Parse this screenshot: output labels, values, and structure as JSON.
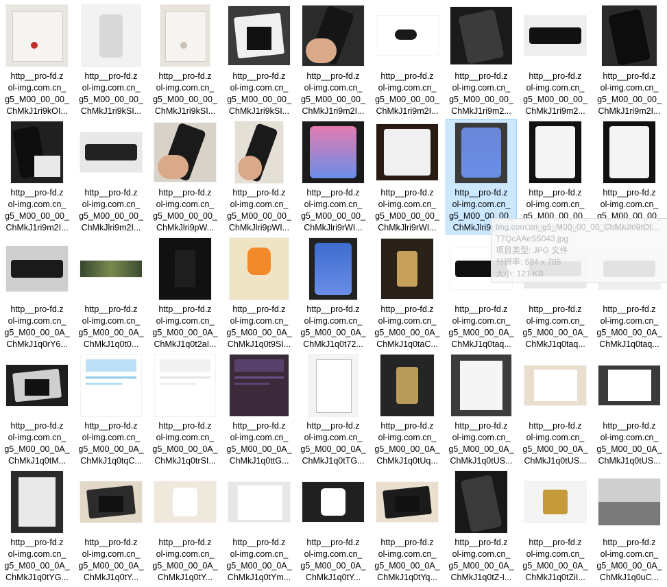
{
  "explorer": {
    "items": [
      {
        "line1": "http__pro-fd.z",
        "line2": "ol-img.com.cn_",
        "line3": "g5_M00_00_00_",
        "line4": "ChMkJ1ri9kOI...",
        "thumb": {
          "w": 90,
          "h": 90,
          "bg": "#e9e6e2",
          "fg": "#c0302a",
          "kind": "box"
        }
      },
      {
        "line1": "http__pro-fd.z",
        "line2": "ol-img.com.cn_",
        "line3": "g5_M00_00_00_",
        "line4": "ChMkJ1ri9kSI...",
        "thumb": {
          "w": 86,
          "h": 90,
          "bg": "#f2f2f2",
          "fg": "#d8d8d8",
          "kind": "charger"
        }
      },
      {
        "line1": "http__pro-fd.z",
        "line2": "ol-img.com.cn_",
        "line3": "g5_M00_00_00_",
        "line4": "ChMkJ1ri9kSI...",
        "thumb": {
          "w": 72,
          "h": 90,
          "bg": "#e8e4dc",
          "fg": "#c9c2b5",
          "kind": "box"
        }
      },
      {
        "line1": "http__pro-fd.z",
        "line2": "ol-img.com.cn_",
        "line3": "g5_M00_00_00_",
        "line4": "ChMkJ1ri9kSI...",
        "thumb": {
          "w": 90,
          "h": 86,
          "bg": "#3a3a3a",
          "fg": "#f0f0f0",
          "kind": "phonebox"
        }
      },
      {
        "line1": "http__pro-fd.z",
        "line2": "ol-img.com.cn_",
        "line3": "g5_M00_00_00_",
        "line4": "ChMkJ1ri9m2I...",
        "thumb": {
          "w": 90,
          "h": 88,
          "bg": "#2b2b2b",
          "fg": "#151515",
          "kind": "hand"
        }
      },
      {
        "line1": "http__pro-fd.z",
        "line2": "ol-img.com.cn_",
        "line3": "g5_M00_00_00_",
        "line4": "ChMkJ1ri9m2I...",
        "thumb": {
          "w": 90,
          "h": 58,
          "bg": "#ffffff",
          "fg": "#1a1a1a",
          "kind": "camera"
        }
      },
      {
        "line1": "http__pro-fd.z",
        "line2": "ol-img.com.cn_",
        "line3": "g5_M00_00_00_",
        "line4": "ChMkJ1ri9m2...",
        "thumb": {
          "w": 90,
          "h": 84,
          "bg": "#1a1a1a",
          "fg": "#3b3b3b",
          "kind": "phone"
        }
      },
      {
        "line1": "http__pro-fd.z",
        "line2": "ol-img.com.cn_",
        "line3": "g5_M00_00_00_",
        "line4": "ChMkJ1ri9m2...",
        "thumb": {
          "w": 90,
          "h": 58,
          "bg": "#eeeeee",
          "fg": "#111111",
          "kind": "phoneflat"
        }
      },
      {
        "line1": "http__pro-fd.z",
        "line2": "ol-img.com.cn_",
        "line3": "g5_M00_00_00_",
        "line4": "ChMkJ1ri9m2I...",
        "thumb": {
          "w": 80,
          "h": 88,
          "bg": "#2a2a2a",
          "fg": "#0d0d0d",
          "kind": "phone"
        }
      },
      {
        "line1": "http__pro-fd.z",
        "line2": "ol-img.com.cn_",
        "line3": "g5_M00_00_00_",
        "line4": "ChMkJ1ri9m2I...",
        "thumb": {
          "w": 76,
          "h": 90,
          "bg": "#202020",
          "fg": "#e9e9e9",
          "kind": "phonewhite"
        }
      },
      {
        "line1": "http__pro-fd.z",
        "line2": "ol-img.com.cn_",
        "line3": "g5_M00_00_00_",
        "line4": "ChMkJlri9m2I...",
        "thumb": {
          "w": 90,
          "h": 58,
          "bg": "#e8e8e8",
          "fg": "#222222",
          "kind": "phoneflat"
        }
      },
      {
        "line1": "http__pro-fd.z",
        "line2": "ol-img.com.cn_",
        "line3": "g5_M00_00_00_",
        "line4": "ChMkJlri9pW...",
        "thumb": {
          "w": 90,
          "h": 86,
          "bg": "#d8d2c8",
          "fg": "#1a1a1a",
          "kind": "hand"
        }
      },
      {
        "line1": "http__pro-fd.z",
        "line2": "ol-img.com.cn_",
        "line3": "g5_M00_00_00_",
        "line4": "ChMkJlri9pWI...",
        "thumb": {
          "w": 70,
          "h": 90,
          "bg": "#e5e0d6",
          "fg": "#1a1a1a",
          "kind": "hand"
        }
      },
      {
        "line1": "http__pro-fd.z",
        "line2": "ol-img.com.cn_",
        "line3": "g5_M00_00_00_",
        "line4": "ChMkJlri9rWI...",
        "thumb": {
          "w": 90,
          "h": 90,
          "bg": "#1b1b1b",
          "fg": "#e47bb0",
          "kind": "screen"
        }
      },
      {
        "line1": "http__pro-fd.z",
        "line2": "ol-img.com.cn_",
        "line3": "g5_M00_00_00_",
        "line4": "ChMkJlri9rWI...",
        "thumb": {
          "w": 90,
          "h": 82,
          "bg": "#2a1a12",
          "fg": "#f0f0f0",
          "kind": "screenwhite"
        }
      },
      {
        "line1": "http__pro-fd.z",
        "line2": "ol-img.com.cn_",
        "line3": "g5_M00_00_00_",
        "line4": "ChMkJlri9tOI...",
        "thumb": {
          "w": 76,
          "h": 88,
          "bg": "#3b3b3b",
          "fg": "#6a86d8",
          "kind": "screen"
        }
      },
      {
        "line1": "http__pro-fd.z",
        "line2": "ol-img.com.cn_",
        "line3": "g5_M00_00_00_",
        "line4": "ChMkJlri9uqIc...",
        "thumb": {
          "w": 76,
          "h": 90,
          "bg": "#111111",
          "fg": "#f4f4f4",
          "kind": "screenwhite"
        }
      },
      {
        "line1": "http__pro-fd.z",
        "line2": "ol-img.com.cn_",
        "line3": "g5_M00_00_00_",
        "line4": "ChMkJlri9uqIS...",
        "thumb": {
          "w": 76,
          "h": 90,
          "bg": "#111111",
          "fg": "#f4f4f4",
          "kind": "screenwhite"
        }
      },
      {
        "line1": "http__pro-fd.z",
        "line2": "ol-img.com.cn_",
        "line3": "g5_M00_00_0A_",
        "line4": "ChMkJ1q0rY6...",
        "thumb": {
          "w": 90,
          "h": 66,
          "bg": "#cfcfcf",
          "fg": "#1a1a1a",
          "kind": "phoneflat"
        }
      },
      {
        "line1": "http__pro-fd.z",
        "line2": "ol-img.com.cn_",
        "line3": "g5_M00_00_0A_",
        "line4": "ChMkJ1q0t0...",
        "thumb": {
          "w": 90,
          "h": 24,
          "bg": "#3b4a3a",
          "fg": "#c9b36a",
          "kind": "game"
        }
      },
      {
        "line1": "http__pro-fd.z",
        "line2": "ol-img.com.cn_",
        "line3": "g5_M00_00_0A_",
        "line4": "ChMkJ1q0t2aI...",
        "thumb": {
          "w": 76,
          "h": 90,
          "bg": "#111111",
          "fg": "#1e1e1e",
          "kind": "dark"
        }
      },
      {
        "line1": "http__pro-fd.z",
        "line2": "ol-img.com.cn_",
        "line3": "g5_M00_00_0A_",
        "line4": "ChMkJ1q0t9SI...",
        "thumb": {
          "w": 86,
          "h": 90,
          "bg": "#efe4c4",
          "fg": "#f2892a",
          "kind": "app"
        }
      },
      {
        "line1": "http__pro-fd.z",
        "line2": "ol-img.com.cn_",
        "line3": "g5_M00_00_0A_",
        "line4": "ChMkJ1q0t72...",
        "thumb": {
          "w": 70,
          "h": 90,
          "bg": "#222222",
          "fg": "#3d6ccf",
          "kind": "screen"
        }
      },
      {
        "line1": "http__pro-fd.z",
        "line2": "ol-img.com.cn_",
        "line3": "g5_M00_00_0A_",
        "line4": "ChMkJ1q0taC...",
        "thumb": {
          "w": 76,
          "h": 88,
          "bg": "#2a2218",
          "fg": "#c8a05a",
          "kind": "gold"
        }
      },
      {
        "line1": "http__pro-fd.z",
        "line2": "ol-img.com.cn_",
        "line3": "g5_M00_00_0A_",
        "line4": "ChMkJ1q0taq...",
        "thumb": {
          "w": 90,
          "h": 60,
          "bg": "#ffffff",
          "fg": "#101010",
          "kind": "phoneflat"
        }
      },
      {
        "line1": "http__pro-fd.z",
        "line2": "ol-img.com.cn_",
        "line3": "g5_M00_00_0A_",
        "line4": "ChMkJ1q0taq...",
        "thumb": {
          "w": 90,
          "h": 56,
          "bg": "#e8e8e8",
          "fg": "#222222",
          "kind": "phoneflat"
        }
      },
      {
        "line1": "http__pro-fd.z",
        "line2": "ol-img.com.cn_",
        "line3": "g5_M00_00_0A_",
        "line4": "ChMkJ1q0taq...",
        "thumb": {
          "w": 90,
          "h": 60,
          "bg": "#eeeeee",
          "fg": "#1b1b1b",
          "kind": "phoneflat"
        }
      },
      {
        "line1": "http__pro-fd.z",
        "line2": "ol-img.com.cn_",
        "line3": "g5_M00_00_0A_",
        "line4": "ChMkJ1q0tM...",
        "thumb": {
          "w": 90,
          "h": 60,
          "bg": "#1e1e1e",
          "fg": "#cfcfcf",
          "kind": "phonebox"
        }
      },
      {
        "line1": "http__pro-fd.z",
        "line2": "ol-img.com.cn_",
        "line3": "g5_M00_00_0A_",
        "line4": "ChMkJ1q0tqC...",
        "thumb": {
          "w": 88,
          "h": 90,
          "bg": "#ffffff",
          "fg": "#3fa9e6",
          "kind": "ui"
        }
      },
      {
        "line1": "http__pro-fd.z",
        "line2": "ol-img.com.cn_",
        "line3": "g5_M00_00_0A_",
        "line4": "ChMkJ1q0trSI...",
        "thumb": {
          "w": 88,
          "h": 90,
          "bg": "#ffffff",
          "fg": "#d4d4d4",
          "kind": "ui"
        }
      },
      {
        "line1": "http__pro-fd.z",
        "line2": "ol-img.com.cn_",
        "line3": "g5_M00_00_0A_",
        "line4": "ChMkJ1q0ttG...",
        "thumb": {
          "w": 86,
          "h": 90,
          "bg": "#3b2a3a",
          "fg": "#8a6cc6",
          "kind": "ui"
        }
      },
      {
        "line1": "http__pro-fd.z",
        "line2": "ol-img.com.cn_",
        "line3": "g5_M00_00_0A_",
        "line4": "ChMkJ1q0tTG...",
        "thumb": {
          "w": 72,
          "h": 90,
          "bg": "#f4f4f4",
          "fg": "#bdbdbd",
          "kind": "doc"
        }
      },
      {
        "line1": "http__pro-fd.z",
        "line2": "ol-img.com.cn_",
        "line3": "g5_M00_00_0A_",
        "line4": "ChMkJ1q0tUq...",
        "thumb": {
          "w": 78,
          "h": 90,
          "bg": "#252525",
          "fg": "#b89c5a",
          "kind": "gold"
        }
      },
      {
        "line1": "http__pro-fd.z",
        "line2": "ol-img.com.cn_",
        "line3": "g5_M00_00_0A_",
        "line4": "ChMkJ1q0tUS...",
        "thumb": {
          "w": 88,
          "h": 90,
          "bg": "#3c3c3c",
          "fg": "#f5f5f5",
          "kind": "boxwhite"
        }
      },
      {
        "line1": "http__pro-fd.z",
        "line2": "ol-img.com.cn_",
        "line3": "g5_M00_00_0A_",
        "line4": "ChMkJ1q0tUS...",
        "thumb": {
          "w": 90,
          "h": 58,
          "bg": "#eadfcf",
          "fg": "#ffffff",
          "kind": "boxwhite"
        }
      },
      {
        "line1": "http__pro-fd.z",
        "line2": "ol-img.com.cn_",
        "line3": "g5_M00_00_0A_",
        "line4": "ChMkJ1q0tUS...",
        "thumb": {
          "w": 90,
          "h": 58,
          "bg": "#3a3a3a",
          "fg": "#ffffff",
          "kind": "boxwhite"
        }
      },
      {
        "line1": "http__pro-fd.z",
        "line2": "ol-img.com.cn_",
        "line3": "g5_M00_00_0A_",
        "line4": "ChMkJ1q0tYG...",
        "thumb": {
          "w": 76,
          "h": 90,
          "bg": "#2a2a2a",
          "fg": "#e9e9e9",
          "kind": "boxwhite"
        }
      },
      {
        "line1": "http__pro-fd.z",
        "line2": "ol-img.com.cn_",
        "line3": "g5_M00_00_0A_",
        "line4": "ChMkJ1q0tY...",
        "thumb": {
          "w": 90,
          "h": 60,
          "bg": "#e1d8c8",
          "fg": "#2b2b2b",
          "kind": "phonebox"
        }
      },
      {
        "line1": "http__pro-fd.z",
        "line2": "ol-img.com.cn_",
        "line3": "g5_M00_00_0A_",
        "line4": "ChMkJ1q0tY...",
        "thumb": {
          "w": 90,
          "h": 60,
          "bg": "#efe8dc",
          "fg": "#ffffff",
          "kind": "charger"
        }
      },
      {
        "line1": "http__pro-fd.z",
        "line2": "ol-img.com.cn_",
        "line3": "g5_M00_00_0A_",
        "line4": "ChMkJ1q0tYm...",
        "thumb": {
          "w": 90,
          "h": 58,
          "bg": "#e7e7e7",
          "fg": "#ffffff",
          "kind": "doc"
        }
      },
      {
        "line1": "http__pro-fd.z",
        "line2": "ol-img.com.cn_",
        "line3": "g5_M00_00_0A_",
        "line4": "ChMkJ1q0tY...",
        "thumb": {
          "w": 90,
          "h": 58,
          "bg": "#202020",
          "fg": "#ffffff",
          "kind": "charger"
        }
      },
      {
        "line1": "http__pro-fd.z",
        "line2": "ol-img.com.cn_",
        "line3": "g5_M00_00_0A_",
        "line4": "ChMkJ1q0tYq...",
        "thumb": {
          "w": 90,
          "h": 58,
          "bg": "#eadfcf",
          "fg": "#1b1b1b",
          "kind": "phonebox"
        }
      },
      {
        "line1": "http__pro-fd.z",
        "line2": "ol-img.com.cn_",
        "line3": "g5_M00_00_0A_",
        "line4": "ChMkJ1q0tZ-I...",
        "thumb": {
          "w": 76,
          "h": 90,
          "bg": "#181818",
          "fg": "#3a3a3a",
          "kind": "phone"
        }
      },
      {
        "line1": "http__pro-fd.z",
        "line2": "ol-img.com.cn_",
        "line3": "g5_M00_00_0A_",
        "line4": "ChMkJ1q0tZiI...",
        "thumb": {
          "w": 90,
          "h": 60,
          "bg": "#f4f4f4",
          "fg": "#c49a3a",
          "kind": "gold"
        }
      },
      {
        "line1": "http__pro-fd.z",
        "line2": "ol-img.com.cn_",
        "line3": "g5_M00_00_0A_",
        "line4": "ChMkJ1q0uC...",
        "thumb": {
          "w": 90,
          "h": 68,
          "bg": "#cfcfcf",
          "fg": "#7a7a7a",
          "kind": "photo"
        }
      }
    ],
    "selected_index": 15,
    "tooltip": {
      "line1": "img.com.cn_g5_M00_00_00_ChMkJlri9tOI...",
      "line2": "T7QcAAeS5043.jpg",
      "line3": "项目类型: JPG 文件",
      "line4": "分辨率: 584 x 705",
      "line5": "大小: 121 KB"
    }
  }
}
